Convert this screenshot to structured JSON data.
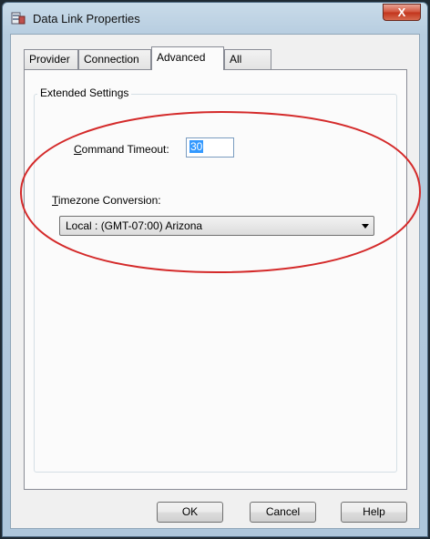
{
  "window": {
    "title": "Data Link Properties",
    "close_glyph": "X"
  },
  "tabs": [
    {
      "label": "Provider",
      "active": false
    },
    {
      "label": "Connection",
      "active": false
    },
    {
      "label": "Advanced",
      "active": true
    },
    {
      "label": "All",
      "active": false
    }
  ],
  "extended_settings": {
    "group_title": "Extended Settings",
    "command_timeout": {
      "label_accel": "C",
      "label_rest": "ommand Timeout:",
      "value": "30"
    },
    "timezone_conversion": {
      "label_accel": "T",
      "label_rest": "imezone Conversion:",
      "selected": "Local : (GMT-07:00) Arizona"
    }
  },
  "buttons": {
    "ok": "OK",
    "cancel": "Cancel",
    "help": "Help"
  },
  "colors": {
    "annotation_ellipse": "#d42a2a",
    "selection_highlight": "#3399ff",
    "close_button": "#c2341c"
  },
  "icons": {
    "app": "data-link-icon",
    "close": "close-icon",
    "dropdown": "chevron-down-icon"
  }
}
